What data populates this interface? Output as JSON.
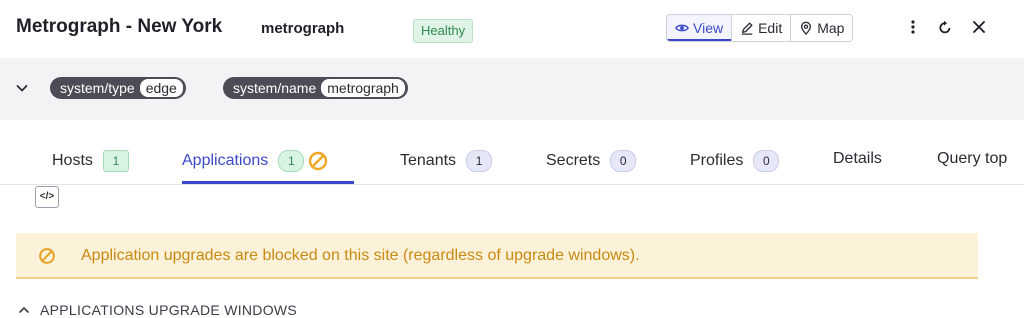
{
  "header": {
    "title": "Metrograph - New York",
    "subtitle": "metrograph",
    "status_badge": "Healthy",
    "view_modes": [
      {
        "label": "View",
        "icon": "eye-icon",
        "active": true
      },
      {
        "label": "Edit",
        "icon": "pencil-icon",
        "active": false
      },
      {
        "label": "Map",
        "icon": "map-pin-icon",
        "active": false
      }
    ]
  },
  "labels": [
    {
      "key": "system/type",
      "value": "edge"
    },
    {
      "key": "system/name",
      "value": "metrograph"
    }
  ],
  "tabs": [
    {
      "label": "Hosts",
      "count": "1"
    },
    {
      "label": "Applications",
      "count": "1",
      "active": true
    },
    {
      "label": "Tenants",
      "count": "1"
    },
    {
      "label": "Secrets",
      "count": "0"
    },
    {
      "label": "Profiles",
      "count": "0"
    },
    {
      "label": "Details"
    },
    {
      "label": "Query top"
    }
  ],
  "code_toggle": "</>",
  "alert": {
    "text": "Application upgrades are blocked on this site (regardless of upgrade windows).",
    "color": "#c98a12"
  },
  "section": {
    "title": "APPLICATIONS UPGRADE WINDOWS"
  },
  "colors": {
    "accent": "#3b49c9",
    "healthy": "#2f8a52",
    "warning": "#f2a623"
  }
}
